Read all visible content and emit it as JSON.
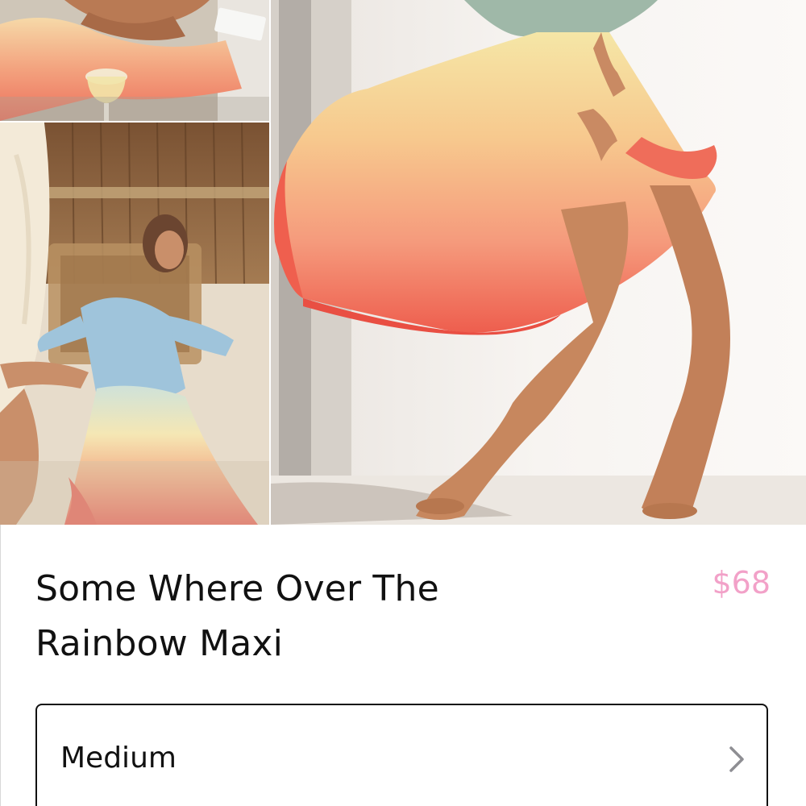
{
  "product": {
    "title": "Some Where Over The Rainbow Maxi",
    "price": "$68",
    "size": {
      "selected": "Medium"
    }
  },
  "icons": {
    "size_chevron": "chevron-right-icon"
  },
  "colors": {
    "price": "#f2a1c8",
    "text": "#111111",
    "border": "#111111"
  }
}
